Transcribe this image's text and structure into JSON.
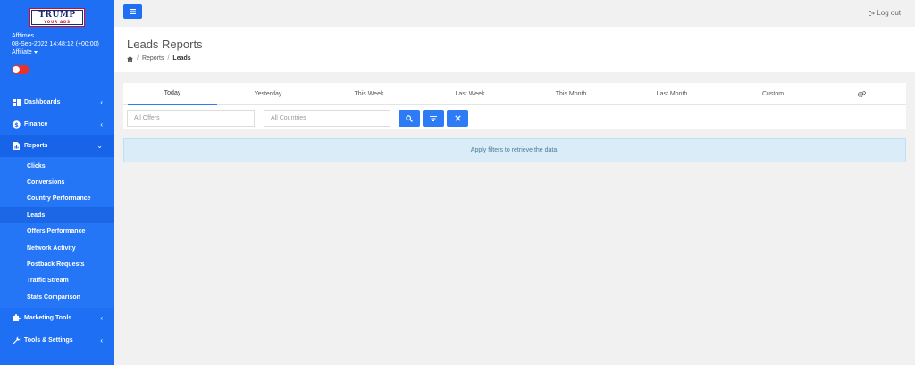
{
  "brand": {
    "logo_top": "TRUMP",
    "logo_bottom": "YOUR ADS"
  },
  "user": {
    "name": "Afftimes",
    "datetime": "08-Sep-2022 14:48:12 (+00:00)",
    "role": "Affiliate"
  },
  "sidebar": {
    "items": [
      {
        "label": "Dashboards",
        "icon": "dashboard-icon"
      },
      {
        "label": "Finance",
        "icon": "finance-icon"
      },
      {
        "label": "Reports",
        "icon": "file-icon"
      },
      {
        "label": "Marketing Tools",
        "icon": "puzzle-icon"
      },
      {
        "label": "Tools & Settings",
        "icon": "wrench-icon"
      }
    ],
    "reports_sub": [
      "Clicks",
      "Conversions",
      "Country Performance",
      "Leads",
      "Offers Performance",
      "Network Activity",
      "Postback Requests",
      "Traffic Stream",
      "Stats Comparison"
    ]
  },
  "topbar": {
    "logout_label": "Log out"
  },
  "header": {
    "title": "Leads Reports",
    "breadcrumb": [
      "Reports",
      "Leads"
    ]
  },
  "tabs": [
    "Today",
    "Yesterday",
    "This Week",
    "Last Week",
    "This Month",
    "Last Month",
    "Custom"
  ],
  "filters": {
    "offers_placeholder": "All Offers",
    "countries_placeholder": "All Countries"
  },
  "alert": {
    "message": "Apply filters to retrieve the data."
  },
  "colors": {
    "sidebar": "#1f6ff5",
    "accent": "#2d7cf6",
    "toggle": "#e8322c"
  }
}
